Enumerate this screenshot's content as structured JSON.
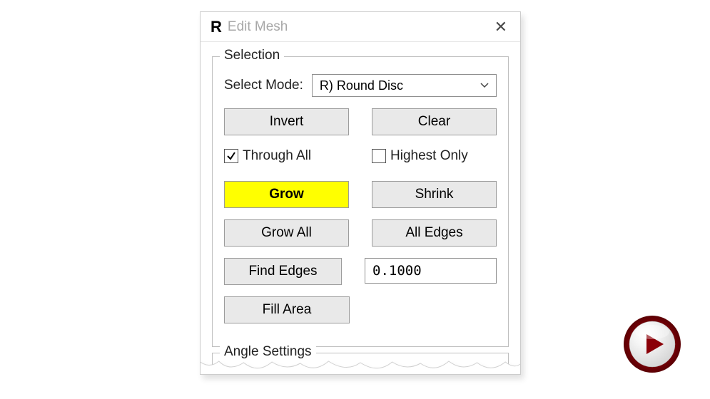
{
  "titlebar": {
    "app_icon": "R",
    "title": "Edit Mesh"
  },
  "selection": {
    "legend": "Selection",
    "select_mode_label": "Select Mode:",
    "select_mode_value": "R) Round Disc",
    "invert": "Invert",
    "clear": "Clear",
    "through_all": "Through All",
    "highest_only": "Highest Only",
    "grow": "Grow",
    "shrink": "Shrink",
    "grow_all": "Grow All",
    "all_edges": "All Edges",
    "find_edges": "Find Edges",
    "edge_value": "0.1000",
    "fill_area": "Fill Area"
  },
  "angle_settings": {
    "legend": "Angle Settings"
  }
}
